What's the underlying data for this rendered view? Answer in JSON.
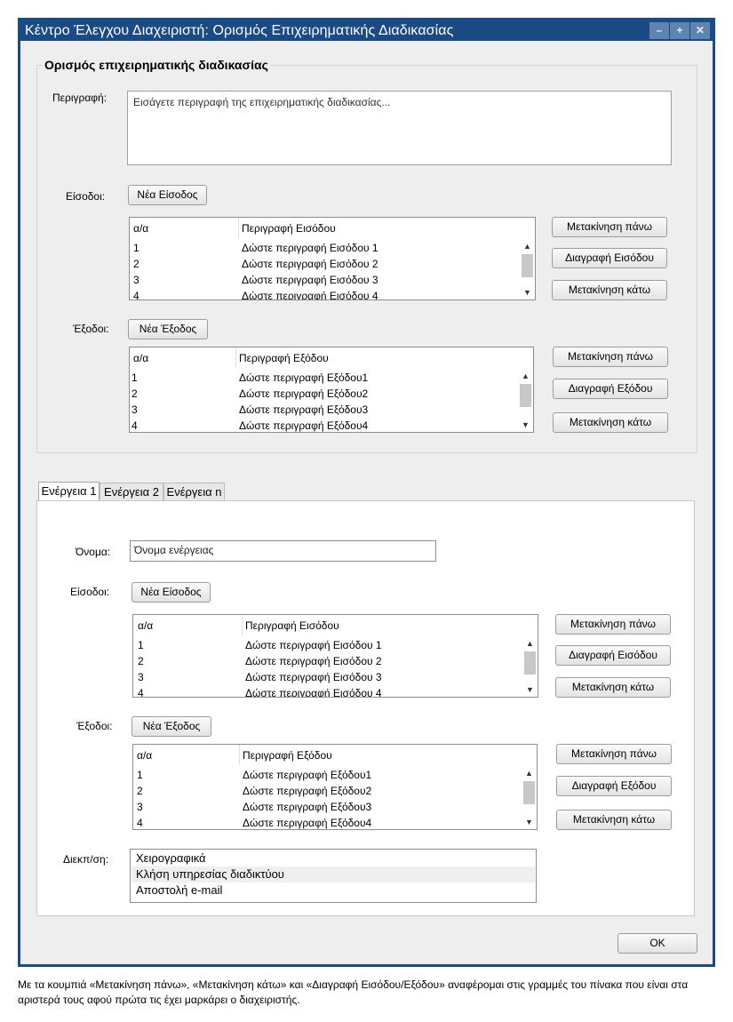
{
  "window": {
    "title": "Κέντρο Έλεγχου Διαχειριστή: Ορισμός Επιχειρηματικής Διαδικασίας",
    "controls": {
      "minimize": "–",
      "maximize": "+",
      "close": "✕"
    }
  },
  "process": {
    "group_title": "Ορισμός επιχειρηματικής διαδικασίας",
    "description_label": "Περιγραφή:",
    "description_placeholder": "Εισάγετε περιγραφή της επιχειρηματικής διαδικασίας...",
    "inputs": {
      "label": "Είσοδοι:",
      "new_button": "Νέα Είσοδος",
      "columns": [
        "α/α",
        "Περιγραφή Εισόδου"
      ],
      "rows": [
        [
          "1",
          "Δώστε περιγραφή Εισόδου 1"
        ],
        [
          "2",
          "Δώστε περιγραφή Εισόδου 2"
        ],
        [
          "3",
          "Δώστε περιγραφή Εισόδου 3"
        ],
        [
          "4",
          "Δώστε περιγραφή Εισόδου 4"
        ]
      ],
      "move_up": "Μετακίνηση πάνω",
      "delete": "Διαγραφή Εισόδου",
      "move_down": "Μετακίνηση κάτω"
    },
    "outputs": {
      "label": "Έξοδοι:",
      "new_button": "Νέα Έξοδος",
      "columns": [
        "α/α",
        "Περιγραφή Εξόδου"
      ],
      "rows": [
        [
          "1",
          "Δώστε περιγραφή Εξόδου1"
        ],
        [
          "2",
          "Δώστε περιγραφή Εξόδου2"
        ],
        [
          "3",
          "Δώστε περιγραφή Εξόδου3"
        ],
        [
          "4",
          "Δώστε περιγραφή Εξόδου4"
        ]
      ],
      "move_up": "Μετακίνηση πάνω",
      "delete": "Διαγραφή Εξόδου",
      "move_down": "Μετακίνηση κάτω"
    }
  },
  "tabs": [
    "Ενέργεια 1",
    "Ενέργεια 2",
    "Ενέργεια n"
  ],
  "action": {
    "name_label": "Όνομα:",
    "name_value": "Όνομα ενέργειας",
    "inputs": {
      "label": "Είσοδοι:",
      "new_button": "Νέα Είσοδος",
      "columns": [
        "α/α",
        "Περιγραφή Εισόδου"
      ],
      "rows": [
        [
          "1",
          "Δώστε περιγραφή Εισόδου 1"
        ],
        [
          "2",
          "Δώστε περιγραφή Εισόδου 2"
        ],
        [
          "3",
          "Δώστε περιγραφή Εισόδου 3"
        ],
        [
          "4",
          "Δώστε περιγραφή Εισόδου 4"
        ]
      ],
      "move_up": "Μετακίνηση πάνω",
      "delete": "Διαγραφή Εισόδου",
      "move_down": "Μετακίνηση κάτω"
    },
    "outputs": {
      "label": "Έξοδοι:",
      "new_button": "Νέα Έξοδος",
      "columns": [
        "α/α",
        "Περιγραφή Εξόδου"
      ],
      "rows": [
        [
          "1",
          "Δώστε περιγραφή Εξόδου1"
        ],
        [
          "2",
          "Δώστε περιγραφή Εξόδου2"
        ],
        [
          "3",
          "Δώστε περιγραφή Εξόδου3"
        ],
        [
          "4",
          "Δώστε περιγραφή Εξόδου4"
        ]
      ],
      "move_up": "Μετακίνηση πάνω",
      "delete": "Διαγραφή Εξόδου",
      "move_down": "Μετακίνηση κάτω"
    },
    "interface_label": "Διεκπ/ση:",
    "interface_options": [
      "Χειρογραφικά",
      "Κλήση υπηρεσίας διαδικτύου",
      "Αποστολή e-mail"
    ],
    "interface_selected": 1
  },
  "ok_button": "OK",
  "footnote": "Με τα κουμπιά «Μετακίνηση πάνω», «Μετακίνηση κάτω» και «Διαγραφή Εισόδου/Εξόδου» αναφέρομαι στις γραμμές του πίνακα που είναι στα αριστερά τους αφού πρώτα τις έχει μαρκάρει ο διαχειριστής."
}
